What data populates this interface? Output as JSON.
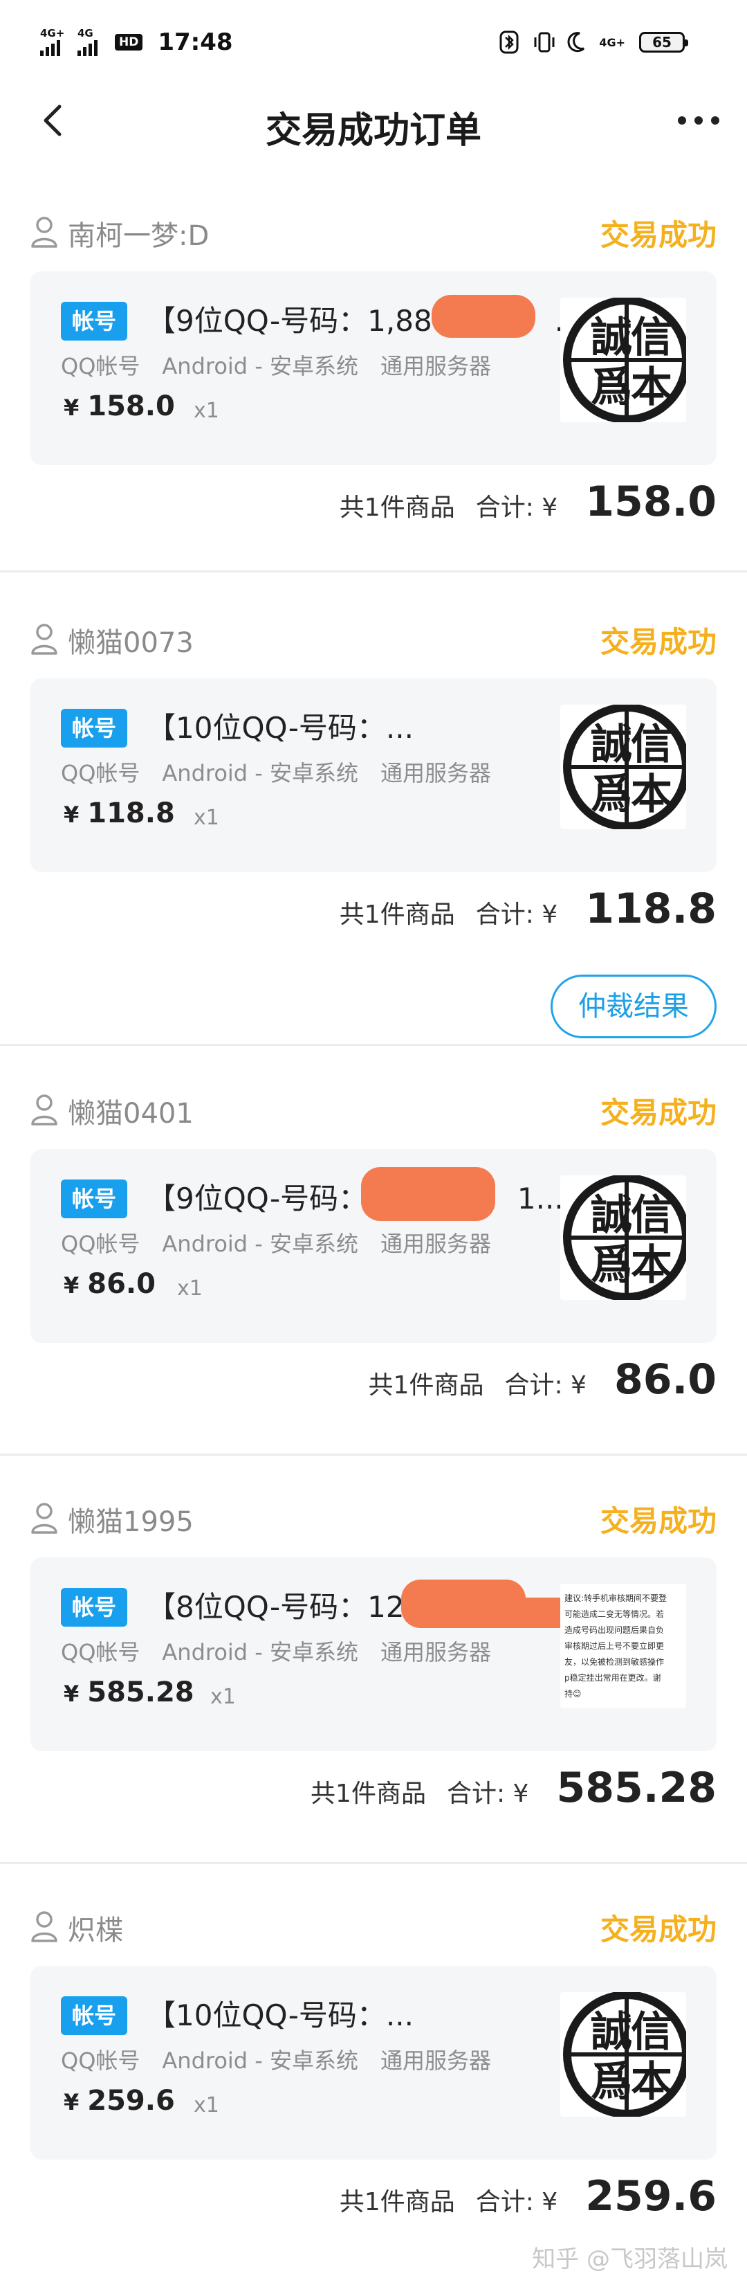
{
  "status_bar": {
    "network_1": "4G+",
    "network_2": "4G",
    "hd": "HD",
    "time": "17:48",
    "network_3": "4G+",
    "battery": "65"
  },
  "header": {
    "title": "交易成功订单"
  },
  "orders": [
    {
      "shop": "南柯一梦:D",
      "status": "交易成功",
      "badge": "帐号",
      "title": "【9位QQ-号码：1,888",
      "title_tail": "…",
      "tags": [
        "QQ帐号",
        "Android - 安卓系统",
        "通用服务器"
      ],
      "currency": "¥",
      "price": "158.0",
      "qty": "x1",
      "count": "共1件商品",
      "total_label": "合计:",
      "total": "158.0",
      "thumb": "seal"
    },
    {
      "shop": "懒猫0073",
      "status": "交易成功",
      "badge": "帐号",
      "title": "【10位QQ-号码：...",
      "tags": [
        "QQ帐号",
        "Android - 安卓系统",
        "通用服务器"
      ],
      "currency": "¥",
      "price": "118.8",
      "qty": "x1",
      "count": "共1件商品",
      "total_label": "合计:",
      "total": "118.8",
      "thumb": "seal",
      "action": "仲裁结果"
    },
    {
      "shop": "懒猫0401",
      "status": "交易成功",
      "badge": "帐号",
      "title": "【9位QQ-号码：1",
      "title_tail": "1...",
      "tags": [
        "QQ帐号",
        "Android - 安卓系统",
        "通用服务器"
      ],
      "currency": "¥",
      "price": "86.0",
      "qty": "x1",
      "count": "共1件商品",
      "total_label": "合计:",
      "total": "86.0",
      "thumb": "seal"
    },
    {
      "shop": "懒猫1995",
      "status": "交易成功",
      "badge": "帐号",
      "title": "【8位QQ-号码：122",
      "tags": [
        "QQ帐号",
        "Android - 安卓系统",
        "通用服务器"
      ],
      "currency": "¥",
      "price": "585.28",
      "qty": "x1",
      "count": "共1件商品",
      "total_label": "合计:",
      "total": "585.28",
      "thumb": "text-note",
      "thumb_text": [
        "建议:转手机审核期间不要登",
        "可能造成二变无等情况。若",
        "造成号码出现问题后果自负",
        "审核期过后上号不要立即更",
        "友，以免被检测到敏感操作",
        "p稳定挂出常用在更改。谢",
        "持😊"
      ]
    },
    {
      "shop": "炽楪",
      "status": "交易成功",
      "badge": "帐号",
      "title": "【10位QQ-号码：...",
      "tags": [
        "QQ帐号",
        "Android - 安卓系统",
        "通用服务器"
      ],
      "currency": "¥",
      "price": "259.6",
      "qty": "x1",
      "count": "共1件商品",
      "total_label": "合计:",
      "total": "259.6",
      "thumb": "seal"
    }
  ],
  "seal_chars": [
    "誠",
    "信",
    "爲",
    "本"
  ],
  "watermark": "知乎 @飞羽落山岚",
  "colors": {
    "status": "#f5b01e",
    "badge": "#18a0ee",
    "button": "#22a3e8",
    "card_bg": "#f5f6f8",
    "redact": "#f47a4f"
  },
  "icons": [
    "back-icon",
    "more-icon",
    "user-icon"
  ]
}
